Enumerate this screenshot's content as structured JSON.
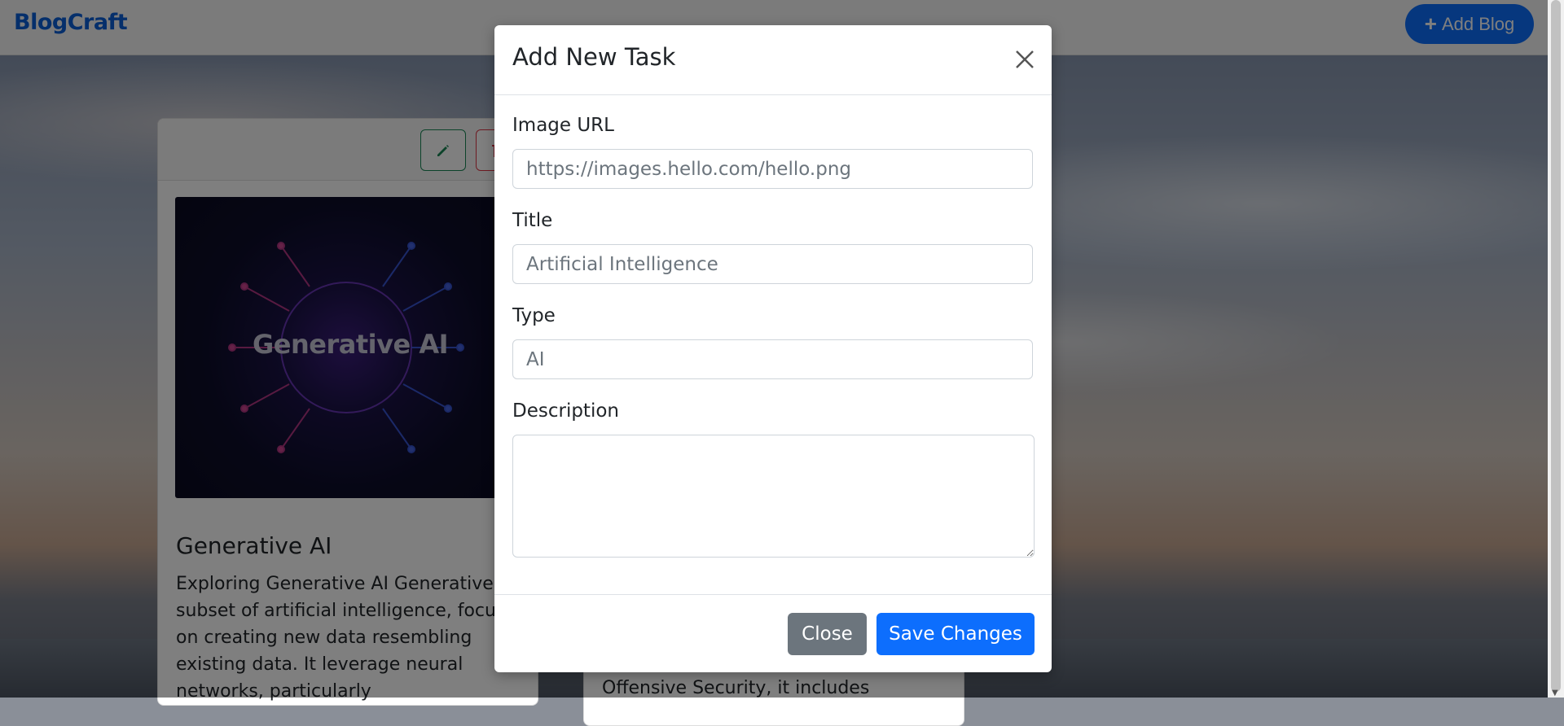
{
  "navbar": {
    "brand": "BlogCraft",
    "add_blog_label": "Add Blog",
    "add_blog_icon": "plus-icon"
  },
  "cards": {
    "first": {
      "image_text": "Generative AI",
      "title": "Generative AI",
      "text": " Exploring Generative AI Generative a subset of artificial intelligence, focuses on creating new data resembling existing data. It leverage neural networks, particularly",
      "edit_icon": "pencil-icon",
      "delete_icon": "trash-icon"
    },
    "second": {
      "text": "Offensive Security, it includes"
    }
  },
  "modal": {
    "title": "Add New Task",
    "close_icon": "close-icon",
    "fields": {
      "image_url": {
        "label": "Image URL",
        "placeholder": "https://images.hello.com/hello.png",
        "value": ""
      },
      "title": {
        "label": "Title",
        "placeholder": "Artificial Intelligence",
        "value": ""
      },
      "type": {
        "label": "Type",
        "placeholder": "AI",
        "value": ""
      },
      "description": {
        "label": "Description",
        "placeholder": "",
        "value": ""
      }
    },
    "footer": {
      "close_label": "Close",
      "save_label": "Save Changes"
    }
  },
  "colors": {
    "primary": "#0d6efd",
    "secondary": "#6c757d",
    "brand": "#0b5ed7",
    "success": "#198754",
    "danger": "#dc3545"
  }
}
